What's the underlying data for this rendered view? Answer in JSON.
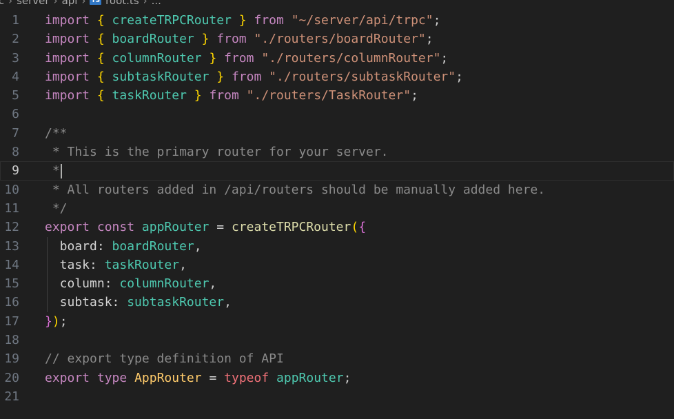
{
  "breadcrumb": {
    "segments": [
      "rc",
      "server",
      "api"
    ],
    "file_badge": "TS",
    "file_name": "root.ts",
    "trail": "..."
  },
  "editor": {
    "current_line": 9,
    "lines": [
      {
        "n": "1",
        "tokens": [
          [
            "import",
            "kw"
          ],
          [
            " ",
            ""
          ],
          [
            "{",
            "yel"
          ],
          [
            " createTRPCRouter ",
            "idn"
          ],
          [
            "}",
            "yel"
          ],
          [
            " ",
            ""
          ],
          [
            "from",
            "kw"
          ],
          [
            " ",
            ""
          ],
          [
            "\"~/server/api/trpc\"",
            "str"
          ],
          [
            ";",
            "punc"
          ]
        ]
      },
      {
        "n": "2",
        "tokens": [
          [
            "import",
            "kw"
          ],
          [
            " ",
            ""
          ],
          [
            "{",
            "yel"
          ],
          [
            " boardRouter ",
            "idn"
          ],
          [
            "}",
            "yel"
          ],
          [
            " ",
            ""
          ],
          [
            "from",
            "kw"
          ],
          [
            " ",
            ""
          ],
          [
            "\"./routers/boardRouter\"",
            "str"
          ],
          [
            ";",
            "punc"
          ]
        ]
      },
      {
        "n": "3",
        "tokens": [
          [
            "import",
            "kw"
          ],
          [
            " ",
            ""
          ],
          [
            "{",
            "yel"
          ],
          [
            " columnRouter ",
            "idn"
          ],
          [
            "}",
            "yel"
          ],
          [
            " ",
            ""
          ],
          [
            "from",
            "kw"
          ],
          [
            " ",
            ""
          ],
          [
            "\"./routers/columnRouter\"",
            "str"
          ],
          [
            ";",
            "punc"
          ]
        ]
      },
      {
        "n": "4",
        "tokens": [
          [
            "import",
            "kw"
          ],
          [
            " ",
            ""
          ],
          [
            "{",
            "yel"
          ],
          [
            " subtaskRouter ",
            "idn"
          ],
          [
            "}",
            "yel"
          ],
          [
            " ",
            ""
          ],
          [
            "from",
            "kw"
          ],
          [
            " ",
            ""
          ],
          [
            "\"./routers/subtaskRouter\"",
            "str"
          ],
          [
            ";",
            "punc"
          ]
        ]
      },
      {
        "n": "5",
        "tokens": [
          [
            "import",
            "kw"
          ],
          [
            " ",
            ""
          ],
          [
            "{",
            "yel"
          ],
          [
            " taskRouter ",
            "idn"
          ],
          [
            "}",
            "yel"
          ],
          [
            " ",
            ""
          ],
          [
            "from",
            "kw"
          ],
          [
            " ",
            ""
          ],
          [
            "\"./routers/TaskRouter\"",
            "str"
          ],
          [
            ";",
            "punc"
          ]
        ]
      },
      {
        "n": "6",
        "tokens": []
      },
      {
        "n": "7",
        "tokens": [
          [
            "/**",
            "cmt"
          ]
        ]
      },
      {
        "n": "8",
        "tokens": [
          [
            " * This is the primary router for your server.",
            "cmt"
          ]
        ]
      },
      {
        "n": "9",
        "tokens": [
          [
            " *",
            "cmt"
          ]
        ],
        "cursor": true
      },
      {
        "n": "10",
        "tokens": [
          [
            " * All routers added in /api/routers should be manually added here.",
            "cmt"
          ]
        ]
      },
      {
        "n": "11",
        "tokens": [
          [
            " */",
            "cmt"
          ]
        ]
      },
      {
        "n": "12",
        "tokens": [
          [
            "export",
            "kw"
          ],
          [
            " ",
            ""
          ],
          [
            "const",
            "kw"
          ],
          [
            " ",
            ""
          ],
          [
            "appRouter",
            "idn"
          ],
          [
            " = ",
            "white"
          ],
          [
            "createTRPCRouter",
            "goldfn"
          ],
          [
            "(",
            "yel"
          ],
          [
            "{",
            "mag"
          ]
        ]
      },
      {
        "n": "13",
        "tokens": [
          [
            "  board: ",
            "white"
          ],
          [
            "boardRouter",
            "idn"
          ],
          [
            ",",
            "punc"
          ]
        ],
        "guide": true
      },
      {
        "n": "14",
        "tokens": [
          [
            "  task: ",
            "white"
          ],
          [
            "taskRouter",
            "idn"
          ],
          [
            ",",
            "punc"
          ]
        ],
        "guide": true
      },
      {
        "n": "15",
        "tokens": [
          [
            "  column: ",
            "white"
          ],
          [
            "columnRouter",
            "idn"
          ],
          [
            ",",
            "punc"
          ]
        ],
        "guide": true
      },
      {
        "n": "16",
        "tokens": [
          [
            "  subtask: ",
            "white"
          ],
          [
            "subtaskRouter",
            "idn"
          ],
          [
            ",",
            "punc"
          ]
        ],
        "guide": true
      },
      {
        "n": "17",
        "tokens": [
          [
            "}",
            "mag"
          ],
          [
            ")",
            "yel"
          ],
          [
            ";",
            "punc"
          ]
        ]
      },
      {
        "n": "18",
        "tokens": []
      },
      {
        "n": "19",
        "tokens": [
          [
            "// export type definition of API",
            "cmt"
          ]
        ]
      },
      {
        "n": "20",
        "tokens": [
          [
            "export",
            "kw"
          ],
          [
            " ",
            ""
          ],
          [
            "type",
            "kw"
          ],
          [
            " ",
            ""
          ],
          [
            "AppRouter",
            "type2"
          ],
          [
            " = ",
            "white"
          ],
          [
            "typeof",
            "typeof"
          ],
          [
            " ",
            ""
          ],
          [
            "appRouter",
            "idn"
          ],
          [
            ";",
            "punc"
          ]
        ]
      },
      {
        "n": "21",
        "tokens": []
      }
    ]
  }
}
